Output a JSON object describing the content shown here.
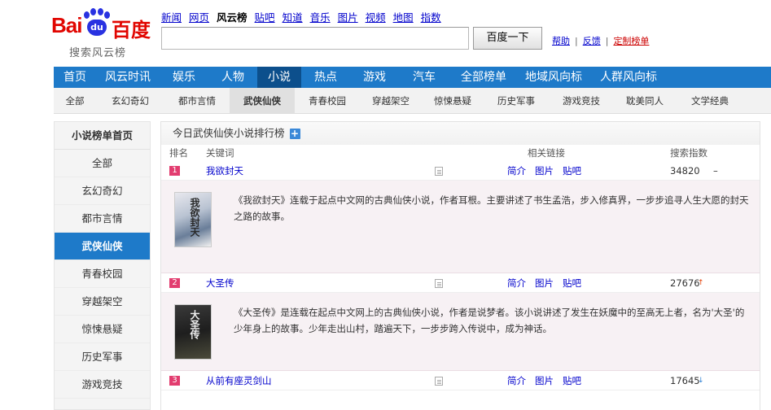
{
  "logo": {
    "brand": "Bai",
    "paw": "du",
    "cn": "百度",
    "sub": "搜索风云榜"
  },
  "topnav": [
    {
      "label": "新闻",
      "current": false
    },
    {
      "label": "网页",
      "current": false
    },
    {
      "label": "风云榜",
      "current": true
    },
    {
      "label": "贴吧",
      "current": false
    },
    {
      "label": "知道",
      "current": false
    },
    {
      "label": "音乐",
      "current": false
    },
    {
      "label": "图片",
      "current": false
    },
    {
      "label": "视频",
      "current": false
    },
    {
      "label": "地图",
      "current": false
    },
    {
      "label": "指数",
      "current": false
    }
  ],
  "search": {
    "value": "",
    "button": "百度一下"
  },
  "links": {
    "help": "帮助",
    "feedback": "反馈",
    "custom": "定制榜单",
    "sep": "|"
  },
  "mainnav": [
    "首页",
    "风云时讯",
    "娱乐",
    "人物",
    "小说",
    "热点",
    "游戏",
    "汽车",
    "全部榜单",
    "地域风向标",
    "人群风向标"
  ],
  "mainnav_active": 4,
  "subnav": [
    "全部",
    "玄幻奇幻",
    "都市言情",
    "武侠仙侠",
    "青春校园",
    "穿越架空",
    "惊悚悬疑",
    "历史军事",
    "游戏竞技",
    "耽美同人",
    "文学经典"
  ],
  "subnav_active": 3,
  "sidebar": {
    "head": "小说榜单首页",
    "items": [
      "全部",
      "玄幻奇幻",
      "都市言情",
      "武侠仙侠",
      "青春校园",
      "穿越架空",
      "惊悚悬疑",
      "历史军事",
      "游戏竞技"
    ],
    "active": 3
  },
  "panel": {
    "title": "今日武侠仙侠小说排行榜",
    "plus": "+",
    "headers": {
      "rank": "排名",
      "keyword": "关键词",
      "links": "相关链接",
      "index": "搜索指数"
    },
    "link_labels": {
      "intro": "简介",
      "image": "图片",
      "tieba": "贴吧"
    },
    "rows": [
      {
        "rank": "1",
        "keyword": "我欲封天",
        "index": "34820",
        "trend": "–",
        "trend_type": "flat",
        "cover_text": "我欲封天",
        "desc": "《我欲封天》连载于起点中文网的古典仙侠小说，作者耳根。主要讲述了书生孟浩，步入修真界，一步步追寻人生大愿的封天之路的故事。"
      },
      {
        "rank": "2",
        "keyword": "大圣传",
        "index": "27676",
        "trend": "↑",
        "trend_type": "up",
        "cover_text": "大圣传",
        "desc": "《大圣传》是连载在起点中文网上的古典仙侠小说，作者是说梦者。该小说讲述了发生在妖魔中的至高无上者，名为'大圣'的少年身上的故事。少年走出山村，踏遍天下，一步步跨入传说中，成为神话。"
      },
      {
        "rank": "3",
        "keyword": "从前有座灵剑山",
        "index": "17645",
        "trend": "↓",
        "trend_type": "down"
      }
    ]
  },
  "colors": {
    "nav_blue": "#1e7ac9",
    "nav_active": "#0c4f8c",
    "rank_badge": "#e23c6f",
    "link": "#0000cc"
  }
}
